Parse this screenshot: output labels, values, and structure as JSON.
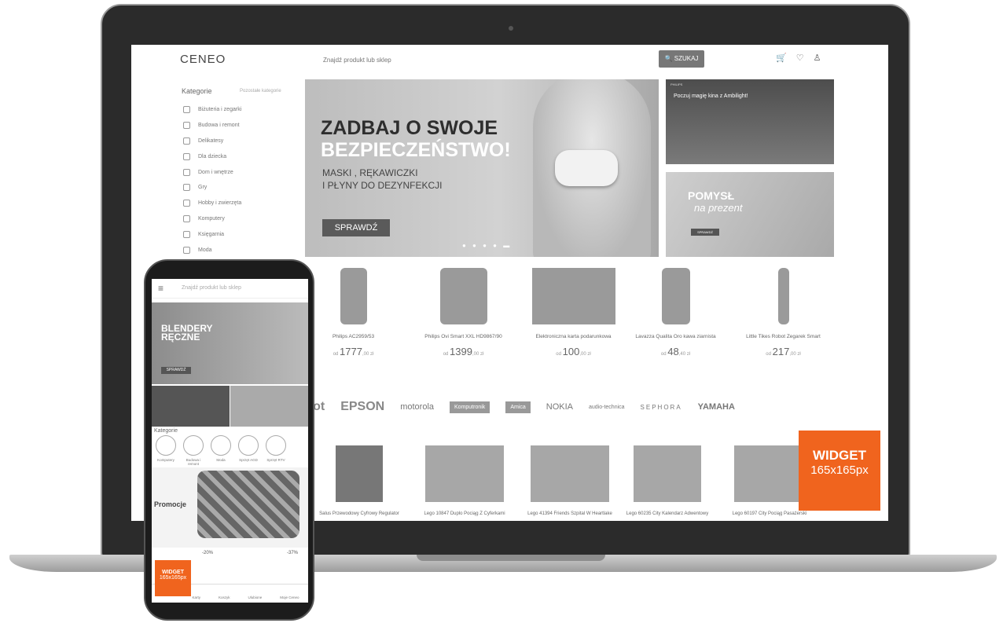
{
  "header": {
    "logo": "CENEO",
    "search_placeholder": "Znajdź produkt lub sklep",
    "search_button": "🔍 SZUKAJ",
    "icons": [
      "cart-icon",
      "heart-icon",
      "user-icon"
    ]
  },
  "sidebar": {
    "title": "Kategorie",
    "subtitle": "Pozostałe kategorie",
    "items": [
      "Biżuteria i zegarki",
      "Budowa i remont",
      "Delikatesy",
      "Dla dziecka",
      "Dom i wnętrze",
      "Gry",
      "Hobby i zwierzęta",
      "Komputery",
      "Księgarnia",
      "Moda"
    ]
  },
  "hero": {
    "line1": "ZADBAJ O SWOJE",
    "line2": "BEZPIECZEŃSTWO!",
    "sub1": "MASKI , RĘKAWICZKI",
    "sub2": "I PŁYNY DO DEZYNFEKCJI",
    "cta": "SPRAWDŹ",
    "dots": "● ● ● ● ▬"
  },
  "promo1": {
    "brand": "PHILIPS",
    "text": "Poczuj magię kina z Ambilight!"
  },
  "promo2": {
    "title": "POMYSŁ",
    "script": "na prezent",
    "button": "SPRAWDŹ"
  },
  "products": [
    {
      "name": "Philips AC2959/53",
      "from": "od",
      "price": "1777",
      "cents": ",00 zł"
    },
    {
      "name": "Philips Ovi Smart XXL HD9867/90",
      "from": "od",
      "price": "1399",
      "cents": ",00 zł"
    },
    {
      "name": "Elektroniczna karta podarunkowa",
      "from": "od",
      "price": "100",
      "cents": ",00 zł"
    },
    {
      "name": "Lavazza Qualita Oro kawa ziarnista",
      "from": "od",
      "price": "48",
      "cents": ",40 zł"
    },
    {
      "name": "Little Tikes Robot Zegarek Smart",
      "from": "od",
      "price": "217",
      "cents": ",00 zł"
    }
  ],
  "brands": [
    "Robot",
    "EPSON",
    "motorola",
    "Komputronik",
    "Amica",
    "NOKIA",
    "audio-technica",
    "SEPHORA",
    "YAMAHA"
  ],
  "bottom_products": [
    "Salus Przewodowy Cyfrowy Regulator",
    "Lego 10847 Duplo Pociąg Z Cyferkami",
    "Lego 41394 Friends Szpital W Heartlake",
    "Lego 60235 City Kalendarz Adwentowy",
    "Lego 60197 City Pociąg Pasażerski"
  ],
  "widget": {
    "title": "WIDGET",
    "size": "165x165px"
  },
  "phone": {
    "search": "Znajdź produkt lub sklep",
    "banner1": "BLENDERY",
    "banner2": "RĘCZNE",
    "banner_btn": "SPRAWDŹ",
    "categories_title": "Kategorie",
    "categories": [
      "Komputery",
      "Budowa i remont",
      "Moda",
      "Sprzęt AGD",
      "Sprzęt RTV"
    ],
    "promo": "Promocje",
    "discount1": "-20%",
    "discount2": "-37%",
    "widget_title": "WIDGET",
    "widget_size": "165x165px",
    "nav": [
      "Karty",
      "Koszyk",
      "Ulubione",
      "Moje Ceneo"
    ]
  },
  "colors": {
    "widget": "#f0641e",
    "lid": "#2b2b2b"
  }
}
